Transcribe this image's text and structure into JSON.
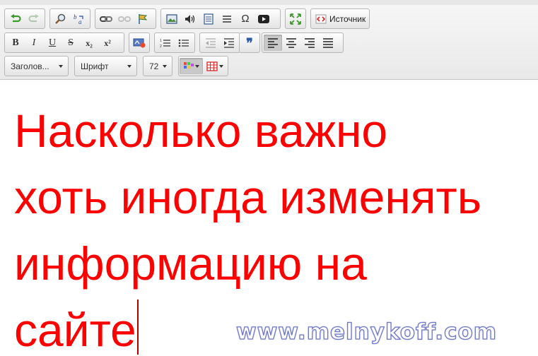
{
  "toolbar": {
    "row1": {
      "source_label": "Источник",
      "icons": [
        "undo-icon",
        "redo-icon",
        "find-icon",
        "replace-icon",
        "link-icon",
        "unlink-icon",
        "anchor-icon",
        "image-icon",
        "audio-icon",
        "table-rows-icon",
        "horizontal-rule-icon",
        "special-char-icon",
        "video-icon",
        "maximize-icon",
        "source-icon"
      ],
      "special_char_glyph": "Ω"
    },
    "row2": {
      "bold": "B",
      "italic": "I",
      "underline": "U",
      "strike": "S",
      "subscript": "x₂",
      "superscript": "x²",
      "quote_glyph": "❞"
    },
    "row3": {
      "format_value": "Заголов...",
      "font_value": "Шрифт",
      "size_value": "72"
    }
  },
  "editor": {
    "lines": [
      "Насколько важно",
      "хоть иногда изменять",
      "информацию на",
      "сайте"
    ],
    "text_color": "#ff0000"
  },
  "watermark": "www.melnykoff.com"
}
